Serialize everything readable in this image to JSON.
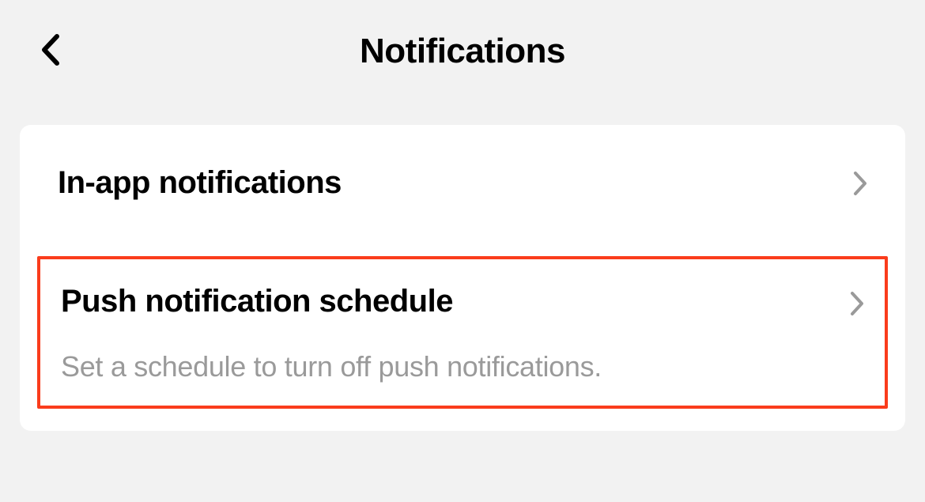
{
  "header": {
    "title": "Notifications"
  },
  "items": [
    {
      "title": "In-app notifications"
    },
    {
      "title": "Push notification schedule",
      "subtitle": "Set a schedule to turn off push notifications."
    }
  ]
}
